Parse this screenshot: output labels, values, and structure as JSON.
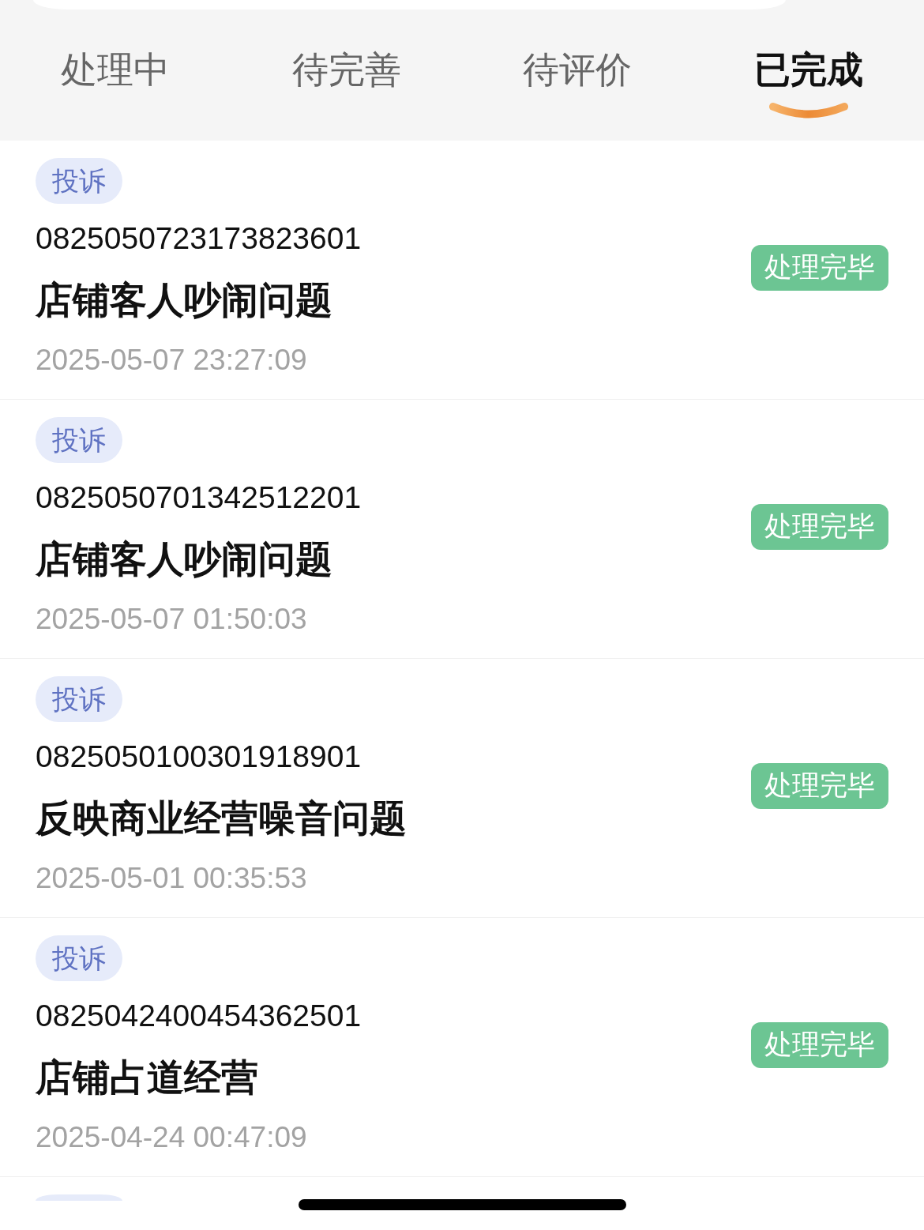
{
  "tabs": [
    {
      "label": "处理中",
      "selected": false
    },
    {
      "label": "待完善",
      "selected": false
    },
    {
      "label": "待评价",
      "selected": false
    },
    {
      "label": "已完成",
      "selected": true
    }
  ],
  "tickets": [
    {
      "tag": "投诉",
      "id": "0825050723173823601",
      "title": "店铺客人吵闹问题",
      "time": "2025-05-07 23:27:09",
      "status": "处理完毕"
    },
    {
      "tag": "投诉",
      "id": "0825050701342512201",
      "title": "店铺客人吵闹问题",
      "time": "2025-05-07 01:50:03",
      "status": "处理完毕"
    },
    {
      "tag": "投诉",
      "id": "0825050100301918901",
      "title": "反映商业经营噪音问题",
      "time": "2025-05-01 00:35:53",
      "status": "处理完毕"
    },
    {
      "tag": "投诉",
      "id": "0825042400454362501",
      "title": "店铺占道经营",
      "time": "2025-04-24 00:47:09",
      "status": "处理完毕"
    }
  ]
}
